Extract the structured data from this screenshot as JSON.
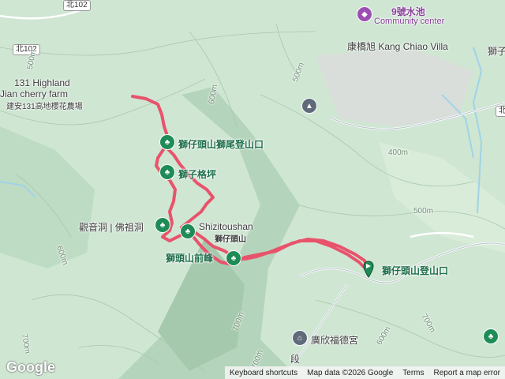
{
  "road_shields": [
    "北102",
    "北102",
    "北"
  ],
  "labels": {
    "pool": "9號水池",
    "community_center": "Community center",
    "villa": "康橋旭 Kang Chiao Villa",
    "lion_partial": "獅子",
    "highland_en1": "131 Highland",
    "highland_en2": "Jian cherry farm",
    "highland_zh": "建安131高地櫻花農場",
    "tail_trailhead": "獅仔頭山獅尾登山口",
    "ping": "獅子格坪",
    "guanyin": "觀音洞 | 佛祖洞",
    "shizitoushan_en": "Shizitoushan",
    "shizitoushan_zh": "獅仔頭山",
    "peak": "獅頭山前峰",
    "trailhead": "獅仔頭山登山口",
    "temple": "廣欣福德宮",
    "road_partial": "段"
  },
  "contours": [
    "500m",
    "500m",
    "600m",
    "400m",
    "500m",
    "600m",
    "700m",
    "700m",
    "700m",
    "600m",
    "700m"
  ],
  "footer": {
    "keyboard": "Keyboard shortcuts",
    "mapdata": "Map data ©2026 Google",
    "terms": "Terms",
    "report": "Report a map error"
  },
  "logo": "Google",
  "colors": {
    "track": "#e8536b",
    "poi": "#1e8c56",
    "water": "#9fd3e8"
  },
  "icons": [
    "tree-icon",
    "graduation-cap-icon",
    "temple-icon",
    "start-pin-icon"
  ]
}
